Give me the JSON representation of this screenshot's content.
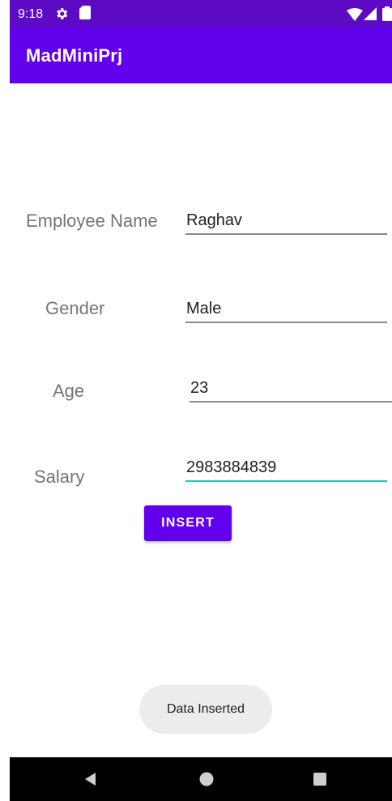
{
  "status_bar": {
    "time": "9:18",
    "icons": [
      "gear-icon",
      "sd-card-icon",
      "wifi-icon",
      "signal-icon",
      "battery-icon"
    ]
  },
  "app_bar": {
    "title": "MadMiniPrj"
  },
  "form": {
    "employee_name": {
      "label": "Employee Name",
      "value": "Raghav"
    },
    "gender": {
      "label": "Gender",
      "value": "Male"
    },
    "age": {
      "label": "Age",
      "value": "23"
    },
    "salary": {
      "label": "Salary",
      "value": "2983884839"
    }
  },
  "actions": {
    "insert_label": "INSERT"
  },
  "toast": {
    "message": "Data Inserted"
  },
  "nav_bar": {
    "icons": [
      "back-icon",
      "home-icon",
      "recents-icon"
    ]
  },
  "colors": {
    "status_bar": "#5c0ac4",
    "primary": "#6200ee",
    "accent": "#26c6b5",
    "toast_bg": "#ececec",
    "nav_bar": "#000000"
  }
}
